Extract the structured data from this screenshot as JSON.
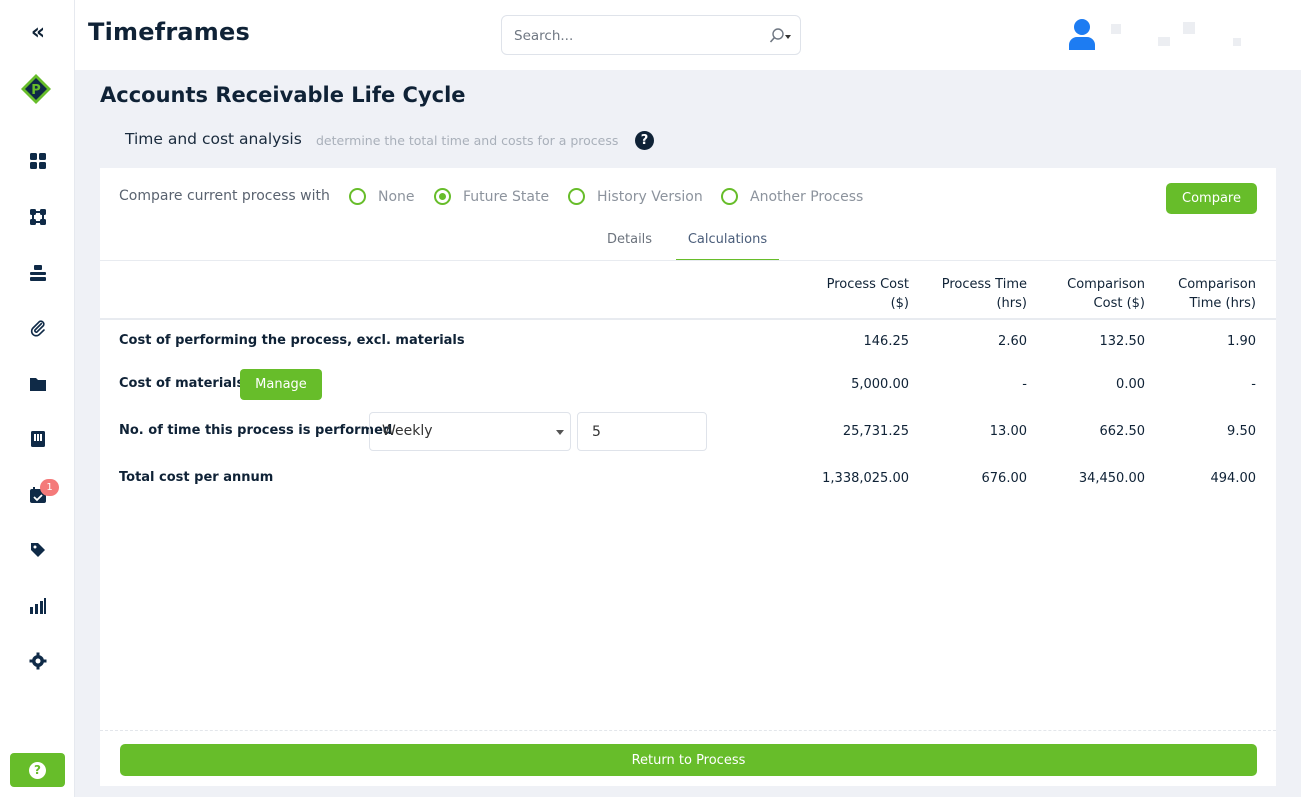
{
  "header": {
    "title": "Timeframes",
    "search_placeholder": "Search..."
  },
  "sidebar": {
    "badge_count": "1"
  },
  "page": {
    "title": "Accounts Receivable Life Cycle",
    "subtitle": "Time and cost analysis",
    "subtitle_desc": "determine the total time and costs for a process"
  },
  "compare": {
    "label": "Compare current process with",
    "options": [
      "None",
      "Future State",
      "History Version",
      "Another Process"
    ],
    "selected": "Future State",
    "button": "Compare"
  },
  "tabs": {
    "details": "Details",
    "calculations": "Calculations",
    "active": "Calculations"
  },
  "table": {
    "headers": {
      "process_cost_1": "Process Cost",
      "process_cost_2": "($)",
      "process_time_1": "Process Time",
      "process_time_2": "(hrs)",
      "comparison_cost_1": "Comparison",
      "comparison_cost_2": "Cost ($)",
      "comparison_time_1": "Comparison",
      "comparison_time_2": "Time (hrs)"
    },
    "rows": [
      {
        "label": "Cost of performing the process, excl. materials",
        "values": [
          "146.25",
          "2.60",
          "132.50",
          "1.90"
        ]
      },
      {
        "label": "Cost of materials",
        "values": [
          "5,000.00",
          "-",
          "0.00",
          "-"
        ]
      },
      {
        "label": "No. of time this process is performed",
        "values": [
          "25,731.25",
          "13.00",
          "662.50",
          "9.50"
        ]
      },
      {
        "label": "Total cost per annum",
        "values": [
          "1,338,025.00",
          "676.00",
          "34,450.00",
          "494.00"
        ]
      }
    ],
    "manage_button": "Manage",
    "frequency_select": "Weekly",
    "frequency_value": "5"
  },
  "footer": {
    "return_button": "Return to Process"
  }
}
